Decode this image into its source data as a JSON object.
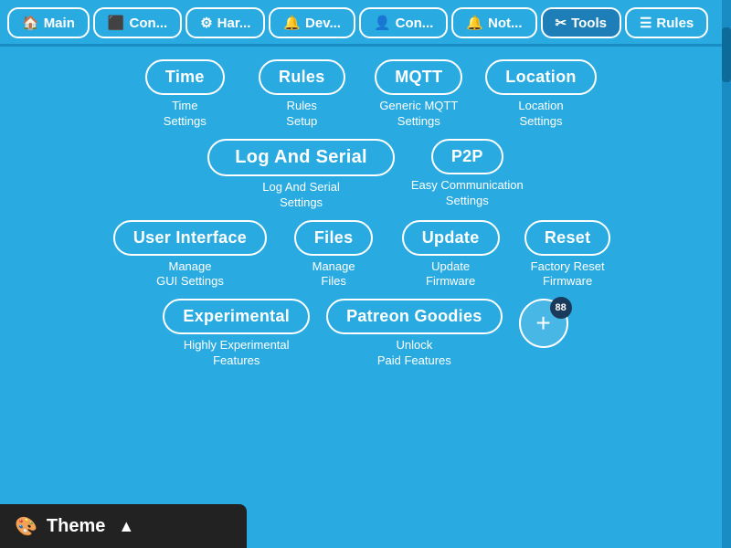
{
  "nav": {
    "tabs": [
      {
        "id": "main",
        "icon": "🏠",
        "label": "Main",
        "active": false
      },
      {
        "id": "con1",
        "icon": "⬛",
        "label": "Con...",
        "active": false
      },
      {
        "id": "hardware",
        "icon": "⚙",
        "label": "Har...",
        "active": false
      },
      {
        "id": "dev",
        "icon": "🔔",
        "label": "Dev...",
        "active": false
      },
      {
        "id": "con2",
        "icon": "👤",
        "label": "Con...",
        "active": false
      },
      {
        "id": "not",
        "icon": "🔔",
        "label": "Not...",
        "active": false
      },
      {
        "id": "tools",
        "icon": "✂",
        "label": "Tools",
        "active": true
      },
      {
        "id": "rules",
        "icon": "☰",
        "label": "Rules",
        "active": false
      }
    ]
  },
  "tools": {
    "row1": [
      {
        "id": "time",
        "btn_label": "Time",
        "desc_line1": "Time",
        "desc_line2": "Settings"
      },
      {
        "id": "rules",
        "btn_label": "Rules",
        "desc_line1": "Rules",
        "desc_line2": "Setup"
      },
      {
        "id": "mqtt",
        "btn_label": "MQTT",
        "desc_line1": "Generic MQTT",
        "desc_line2": "Settings"
      },
      {
        "id": "location",
        "btn_label": "Location",
        "desc_line1": "Location",
        "desc_line2": "Settings"
      }
    ],
    "row2": [
      {
        "id": "log-serial",
        "btn_label": "Log And Serial",
        "desc_line1": "Log And Serial",
        "desc_line2": "Settings",
        "wide": true
      },
      {
        "id": "p2p",
        "btn_label": "P2P",
        "desc_line1": "Easy Communication",
        "desc_line2": "Settings"
      }
    ],
    "row3": [
      {
        "id": "user-interface",
        "btn_label": "User Interface",
        "desc_line1": "Manage",
        "desc_line2": "GUI Settings"
      },
      {
        "id": "files",
        "btn_label": "Files",
        "desc_line1": "Manage",
        "desc_line2": "Files"
      },
      {
        "id": "update",
        "btn_label": "Update",
        "desc_line1": "Update",
        "desc_line2": "Firmware"
      },
      {
        "id": "reset",
        "btn_label": "Reset",
        "desc_line1": "Factory Reset",
        "desc_line2": "Firmware"
      }
    ],
    "row4_left": [
      {
        "id": "experimental",
        "btn_label": "Experimental",
        "desc_line1": "Highly Experimental",
        "desc_line2": "Features"
      }
    ],
    "row4_right": [
      {
        "id": "patreon",
        "btn_label": "Patreon Goodies",
        "desc_line1": "Unlock",
        "desc_line2": "Paid Features"
      }
    ],
    "plus_badge": "88"
  },
  "bottom": {
    "icon": "🎨",
    "label": "Theme",
    "arrow": "▲"
  }
}
